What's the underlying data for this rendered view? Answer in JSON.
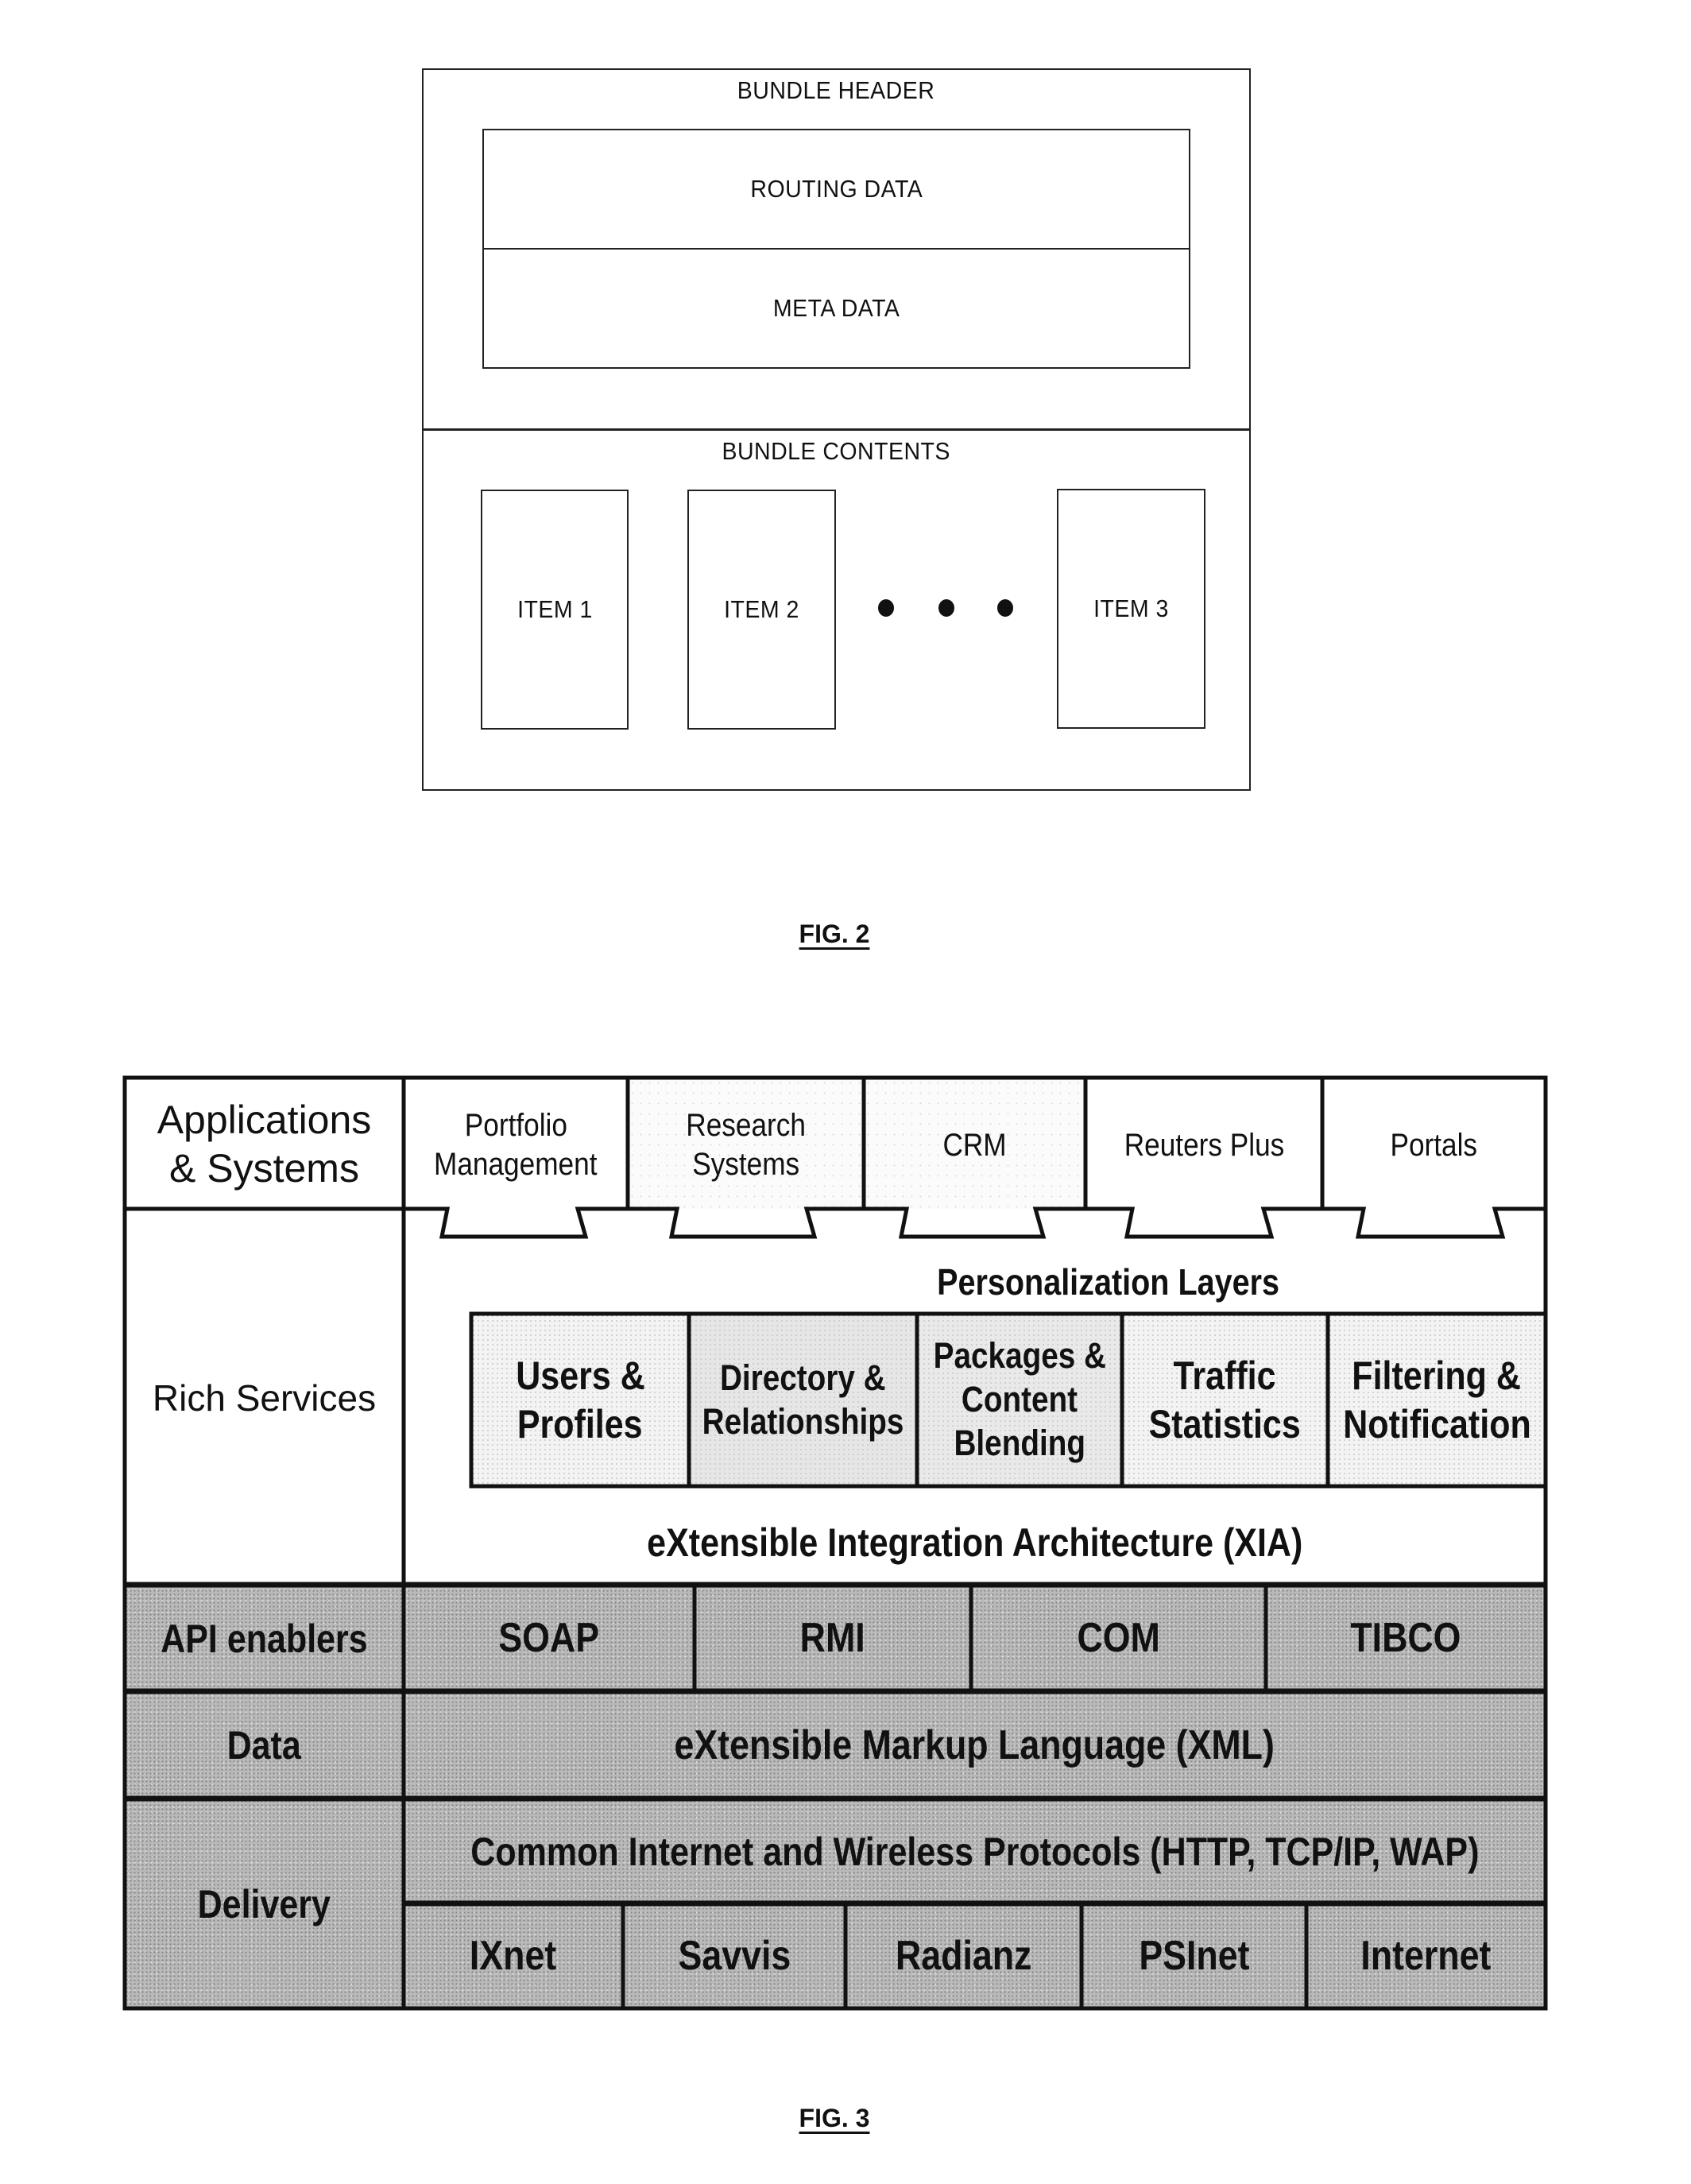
{
  "fig2": {
    "caption": "FIG. 2",
    "bundle_header_label": "BUNDLE HEADER",
    "routing_data_label": "ROUTING DATA",
    "meta_data_label": "META DATA",
    "bundle_contents_label": "BUNDLE CONTENTS",
    "items": [
      "ITEM 1",
      "ITEM 2",
      "ITEM 3"
    ],
    "ellipsis_icon": "three-dots"
  },
  "fig3": {
    "caption": "FIG. 3",
    "applications": {
      "label_line1": "Applications",
      "label_line2": "& Systems",
      "apps": [
        {
          "line1": "Portfolio",
          "line2": "Management"
        },
        {
          "line1": "Research",
          "line2": "Systems"
        },
        {
          "line1": "CRM",
          "line2": ""
        },
        {
          "line1": "Reuters Plus",
          "line2": ""
        },
        {
          "line1": "Portals",
          "line2": ""
        }
      ]
    },
    "rich_services": {
      "label": "Rich Services",
      "personalization_title": "Personalization Layers",
      "layers": [
        {
          "lines": [
            "Users &",
            "Profiles"
          ]
        },
        {
          "lines": [
            "Directory &",
            "Relationships"
          ]
        },
        {
          "lines": [
            "Packages &",
            "Content",
            "Blending"
          ]
        },
        {
          "lines": [
            "Traffic",
            "Statistics"
          ]
        },
        {
          "lines": [
            "Filtering &",
            "Notification"
          ]
        }
      ],
      "xia_label": "eXtensible Integration Architecture (XIA)"
    },
    "api_enablers": {
      "label": "API enablers",
      "items": [
        "SOAP",
        "RMI",
        "COM",
        "TIBCO"
      ]
    },
    "data": {
      "label": "Data",
      "content": "eXtensible Markup Language (XML)"
    },
    "delivery": {
      "label": "Delivery",
      "protocols": "Common Internet and Wireless Protocols (HTTP, TCP/IP, WAP)",
      "networks": [
        "IXnet",
        "Savvis",
        "Radianz",
        "PSInet",
        "Internet"
      ]
    }
  }
}
